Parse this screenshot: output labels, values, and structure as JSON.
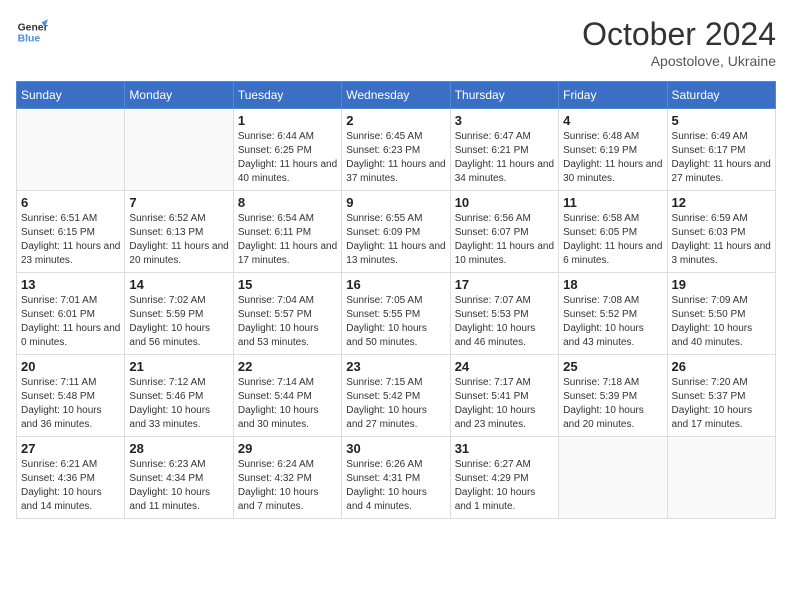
{
  "header": {
    "logo_general": "General",
    "logo_blue": "Blue",
    "month_title": "October 2024",
    "subtitle": "Apostolove, Ukraine"
  },
  "days_of_week": [
    "Sunday",
    "Monday",
    "Tuesday",
    "Wednesday",
    "Thursday",
    "Friday",
    "Saturday"
  ],
  "weeks": [
    [
      {
        "day": "",
        "info": ""
      },
      {
        "day": "",
        "info": ""
      },
      {
        "day": "1",
        "info": "Sunrise: 6:44 AM\nSunset: 6:25 PM\nDaylight: 11 hours and 40 minutes."
      },
      {
        "day": "2",
        "info": "Sunrise: 6:45 AM\nSunset: 6:23 PM\nDaylight: 11 hours and 37 minutes."
      },
      {
        "day": "3",
        "info": "Sunrise: 6:47 AM\nSunset: 6:21 PM\nDaylight: 11 hours and 34 minutes."
      },
      {
        "day": "4",
        "info": "Sunrise: 6:48 AM\nSunset: 6:19 PM\nDaylight: 11 hours and 30 minutes."
      },
      {
        "day": "5",
        "info": "Sunrise: 6:49 AM\nSunset: 6:17 PM\nDaylight: 11 hours and 27 minutes."
      }
    ],
    [
      {
        "day": "6",
        "info": "Sunrise: 6:51 AM\nSunset: 6:15 PM\nDaylight: 11 hours and 23 minutes."
      },
      {
        "day": "7",
        "info": "Sunrise: 6:52 AM\nSunset: 6:13 PM\nDaylight: 11 hours and 20 minutes."
      },
      {
        "day": "8",
        "info": "Sunrise: 6:54 AM\nSunset: 6:11 PM\nDaylight: 11 hours and 17 minutes."
      },
      {
        "day": "9",
        "info": "Sunrise: 6:55 AM\nSunset: 6:09 PM\nDaylight: 11 hours and 13 minutes."
      },
      {
        "day": "10",
        "info": "Sunrise: 6:56 AM\nSunset: 6:07 PM\nDaylight: 11 hours and 10 minutes."
      },
      {
        "day": "11",
        "info": "Sunrise: 6:58 AM\nSunset: 6:05 PM\nDaylight: 11 hours and 6 minutes."
      },
      {
        "day": "12",
        "info": "Sunrise: 6:59 AM\nSunset: 6:03 PM\nDaylight: 11 hours and 3 minutes."
      }
    ],
    [
      {
        "day": "13",
        "info": "Sunrise: 7:01 AM\nSunset: 6:01 PM\nDaylight: 11 hours and 0 minutes."
      },
      {
        "day": "14",
        "info": "Sunrise: 7:02 AM\nSunset: 5:59 PM\nDaylight: 10 hours and 56 minutes."
      },
      {
        "day": "15",
        "info": "Sunrise: 7:04 AM\nSunset: 5:57 PM\nDaylight: 10 hours and 53 minutes."
      },
      {
        "day": "16",
        "info": "Sunrise: 7:05 AM\nSunset: 5:55 PM\nDaylight: 10 hours and 50 minutes."
      },
      {
        "day": "17",
        "info": "Sunrise: 7:07 AM\nSunset: 5:53 PM\nDaylight: 10 hours and 46 minutes."
      },
      {
        "day": "18",
        "info": "Sunrise: 7:08 AM\nSunset: 5:52 PM\nDaylight: 10 hours and 43 minutes."
      },
      {
        "day": "19",
        "info": "Sunrise: 7:09 AM\nSunset: 5:50 PM\nDaylight: 10 hours and 40 minutes."
      }
    ],
    [
      {
        "day": "20",
        "info": "Sunrise: 7:11 AM\nSunset: 5:48 PM\nDaylight: 10 hours and 36 minutes."
      },
      {
        "day": "21",
        "info": "Sunrise: 7:12 AM\nSunset: 5:46 PM\nDaylight: 10 hours and 33 minutes."
      },
      {
        "day": "22",
        "info": "Sunrise: 7:14 AM\nSunset: 5:44 PM\nDaylight: 10 hours and 30 minutes."
      },
      {
        "day": "23",
        "info": "Sunrise: 7:15 AM\nSunset: 5:42 PM\nDaylight: 10 hours and 27 minutes."
      },
      {
        "day": "24",
        "info": "Sunrise: 7:17 AM\nSunset: 5:41 PM\nDaylight: 10 hours and 23 minutes."
      },
      {
        "day": "25",
        "info": "Sunrise: 7:18 AM\nSunset: 5:39 PM\nDaylight: 10 hours and 20 minutes."
      },
      {
        "day": "26",
        "info": "Sunrise: 7:20 AM\nSunset: 5:37 PM\nDaylight: 10 hours and 17 minutes."
      }
    ],
    [
      {
        "day": "27",
        "info": "Sunrise: 6:21 AM\nSunset: 4:36 PM\nDaylight: 10 hours and 14 minutes."
      },
      {
        "day": "28",
        "info": "Sunrise: 6:23 AM\nSunset: 4:34 PM\nDaylight: 10 hours and 11 minutes."
      },
      {
        "day": "29",
        "info": "Sunrise: 6:24 AM\nSunset: 4:32 PM\nDaylight: 10 hours and 7 minutes."
      },
      {
        "day": "30",
        "info": "Sunrise: 6:26 AM\nSunset: 4:31 PM\nDaylight: 10 hours and 4 minutes."
      },
      {
        "day": "31",
        "info": "Sunrise: 6:27 AM\nSunset: 4:29 PM\nDaylight: 10 hours and 1 minute."
      },
      {
        "day": "",
        "info": ""
      },
      {
        "day": "",
        "info": ""
      }
    ]
  ]
}
